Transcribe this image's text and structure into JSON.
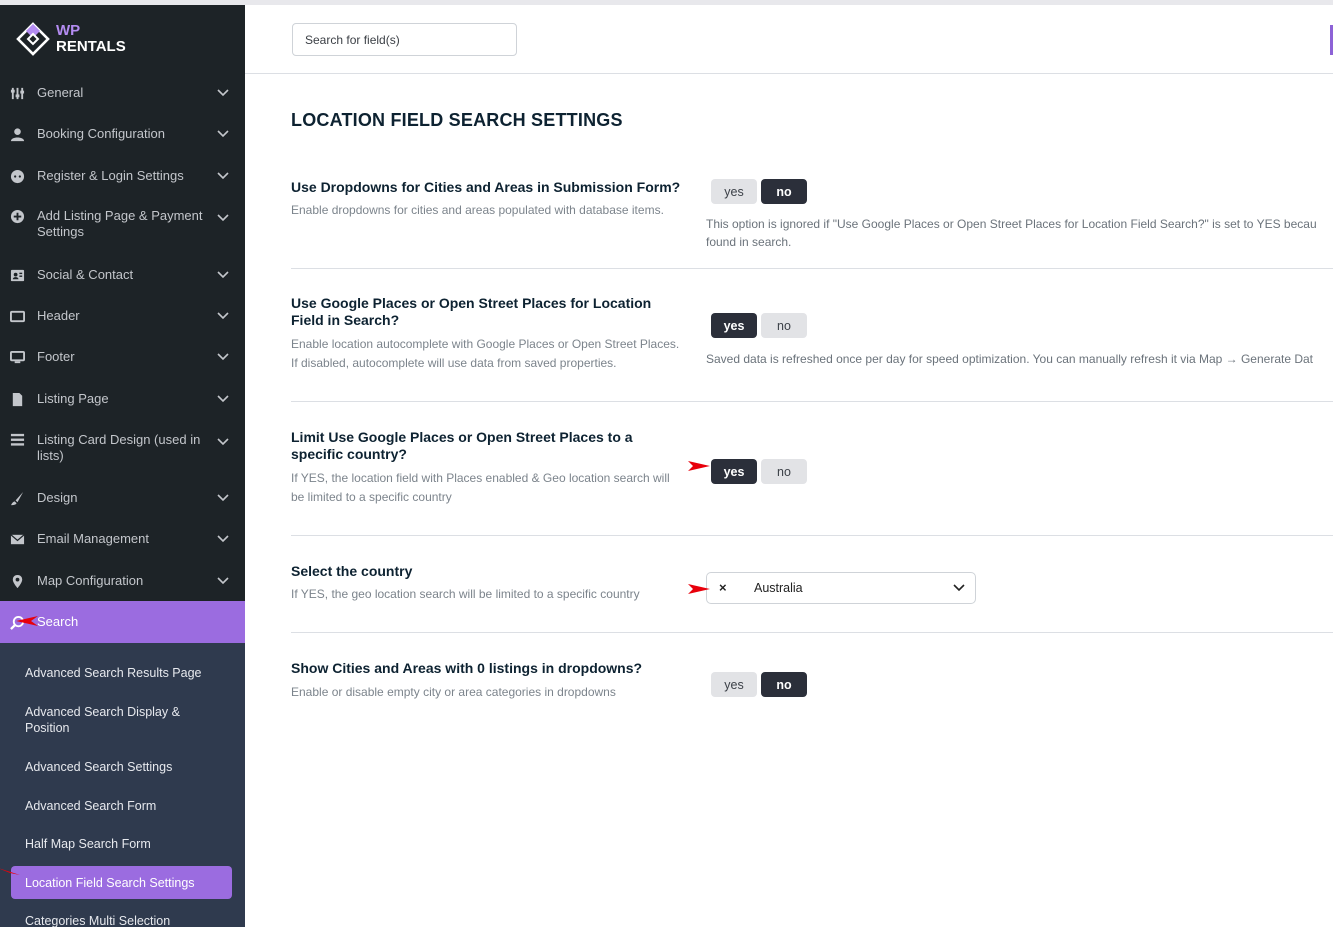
{
  "brand": {
    "line1": "WP",
    "line2": "RENTALS"
  },
  "colors": {
    "sidebar_bg": "#1d2327",
    "accent": "#9b6ce0",
    "submenu_bg": "#2f3a4e",
    "toggle_on": "#2b2f3a",
    "annotation_arrow": "#e8000b"
  },
  "search": {
    "placeholder": "Search for field(s)"
  },
  "sidebar": {
    "items": [
      {
        "label": "General",
        "icon": "sliders-icon"
      },
      {
        "label": "Booking Configuration",
        "icon": "user-icon"
      },
      {
        "label": "Register & Login Settings",
        "icon": "login-icon"
      },
      {
        "label": "Add Listing Page & Payment Settings",
        "icon": "plus-circle-icon"
      },
      {
        "label": "Social & Contact",
        "icon": "contact-card-icon"
      },
      {
        "label": "Header",
        "icon": "monitor-icon"
      },
      {
        "label": "Footer",
        "icon": "desktop-icon"
      },
      {
        "label": "Listing Page",
        "icon": "document-icon"
      },
      {
        "label": "Listing Card Design (used in lists)",
        "icon": "list-icon"
      },
      {
        "label": "Design",
        "icon": "brush-icon"
      },
      {
        "label": "Email Management",
        "icon": "envelope-icon"
      },
      {
        "label": "Map Configuration",
        "icon": "map-pin-icon"
      },
      {
        "label": "Search",
        "icon": "search-icon"
      }
    ],
    "subitems": [
      "Advanced Search Results Page",
      "Advanced Search Display & Position",
      "Advanced Search Settings",
      "Advanced Search Form",
      "Half Map Search Form",
      "Location Field Search Settings",
      "Categories Multi Selection"
    ]
  },
  "main": {
    "title": "LOCATION FIELD SEARCH SETTINGS",
    "settings": [
      {
        "label": "Use Dropdowns for Cities and Areas in Submission Form?",
        "desc": "Enable dropdowns for cities and areas populated with database items.",
        "yes": "yes",
        "no": "no",
        "selected": "no",
        "note": "This option is ignored if \"Use Google Places or Open Street Places for Location Field Search?\" is set to YES becau found in search."
      },
      {
        "label": "Use Google Places or Open Street Places for Location Field in Search?",
        "desc": "Enable location autocomplete with Google Places or Open Street Places. If disabled, autocomplete will use data from saved properties.",
        "yes": "yes",
        "no": "no",
        "selected": "yes",
        "note": "Saved data is refreshed once per day for speed optimization. You can manually refresh it via Map → Generate Dat"
      },
      {
        "label": "Limit Use Google Places or Open Street Places to a specific country?",
        "desc": "If YES, the location field with Places enabled & Geo location search will be limited to a specific country",
        "yes": "yes",
        "no": "no",
        "selected": "yes"
      },
      {
        "label": "Select the country",
        "desc": "If YES, the geo location search will be limited to a specific country",
        "clear_symbol": "×",
        "value": "Australia"
      },
      {
        "label": "Show Cities and Areas with 0 listings in dropdowns?",
        "desc": "Enable or disable empty city or area categories in dropdowns",
        "yes": "yes",
        "no": "no",
        "selected": "no"
      }
    ]
  }
}
